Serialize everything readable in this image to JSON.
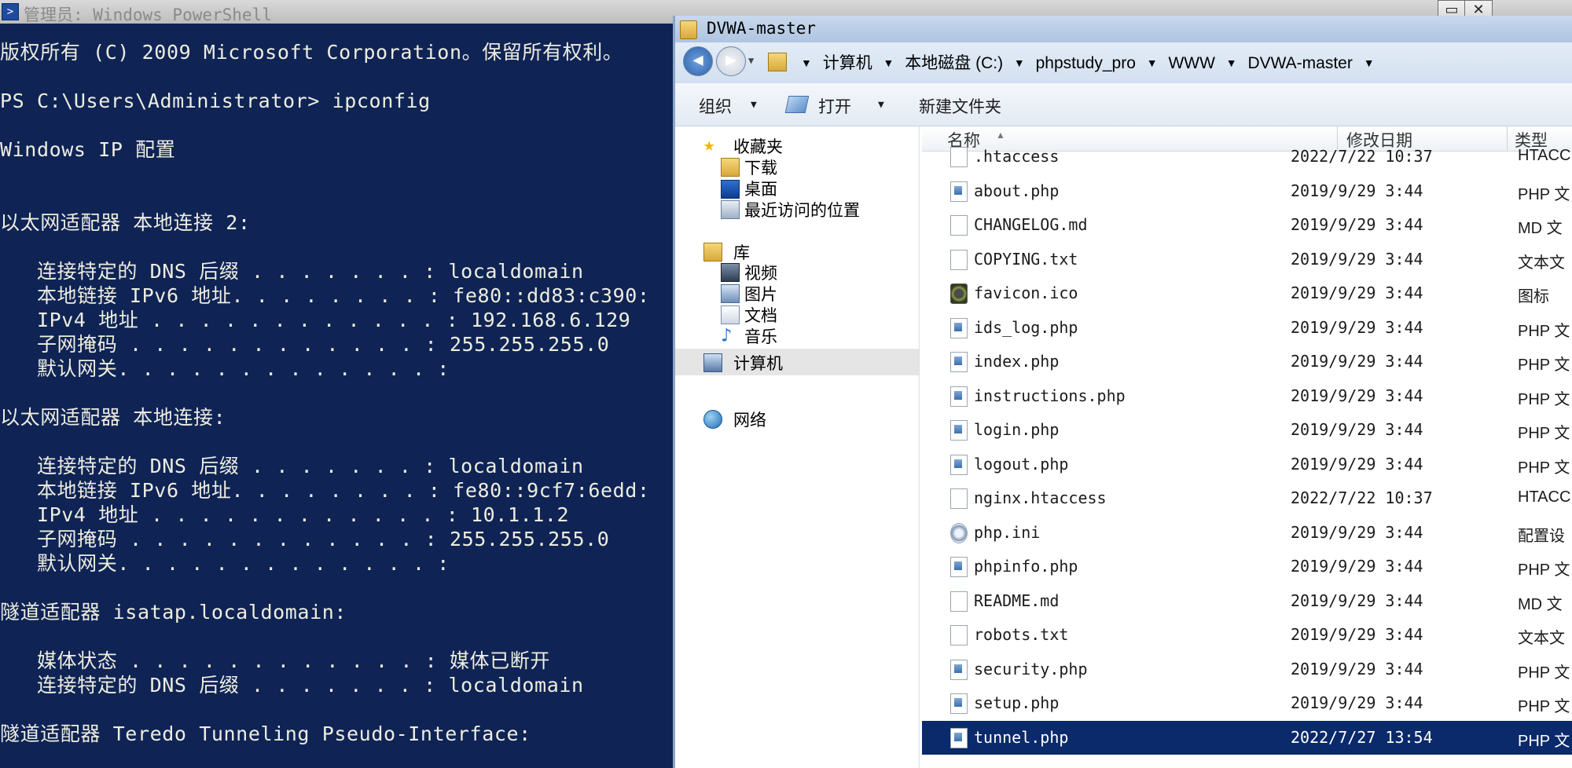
{
  "powershell": {
    "title": "管理员: Windows PowerShell",
    "lines": [
      "版权所有 (C) 2009 Microsoft Corporation。保留所有权利。",
      "",
      "PS C:\\Users\\Administrator> ipconfig",
      "",
      "Windows IP 配置",
      "",
      "",
      "以太网适配器 本地连接 2:",
      "",
      "   连接特定的 DNS 后缀 . . . . . . . : localdomain",
      "   本地链接 IPv6 地址. . . . . . . . : fe80::dd83:c390:",
      "   IPv4 地址 . . . . . . . . . . . . : 192.168.6.129",
      "   子网掩码 . . . . . . . . . . . . : 255.255.255.0",
      "   默认网关. . . . . . . . . . . . . :",
      "",
      "以太网适配器 本地连接:",
      "",
      "   连接特定的 DNS 后缀 . . . . . . . : localdomain",
      "   本地链接 IPv6 地址. . . . . . . . : fe80::9cf7:6edd:",
      "   IPv4 地址 . . . . . . . . . . . . : 10.1.1.2",
      "   子网掩码 . . . . . . . . . . . . : 255.255.255.0",
      "   默认网关. . . . . . . . . . . . . :",
      "",
      "隧道适配器 isatap.localdomain:",
      "",
      "   媒体状态 . . . . . . . . . . . . : 媒体已断开",
      "   连接特定的 DNS 后缀 . . . . . . . : localdomain",
      "",
      "隧道适配器 Teredo Tunneling Pseudo-Interface:",
      "",
      "   媒体状态 . . . . . . . . . . . . : 媒体已断开"
    ]
  },
  "explorer": {
    "title": "DVWA-master",
    "breadcrumb": [
      "计算机",
      "本地磁盘 (C:)",
      "phpstudy_pro",
      "WWW",
      "DVWA-master"
    ],
    "toolbar": {
      "organize": "组织",
      "open": "打开",
      "new_folder": "新建文件夹"
    },
    "nav": {
      "favorites": "收藏夹",
      "downloads": "下载",
      "desktop": "桌面",
      "recent": "最近访问的位置",
      "libraries": "库",
      "videos": "视频",
      "pictures": "图片",
      "documents": "文档",
      "music": "音乐",
      "computer": "计算机",
      "network": "网络"
    },
    "columns": {
      "name": "名称",
      "date": "修改日期",
      "type": "类型"
    },
    "files": [
      {
        "name": ".htaccess",
        "date": "2022/7/22 10:37",
        "type": "HTACC",
        "icon": "blank"
      },
      {
        "name": "about.php",
        "date": "2019/9/29 3:44",
        "type": "PHP 文",
        "icon": "php"
      },
      {
        "name": "CHANGELOG.md",
        "date": "2019/9/29 3:44",
        "type": "MD 文",
        "icon": "blank"
      },
      {
        "name": "COPYING.txt",
        "date": "2019/9/29 3:44",
        "type": "文本文",
        "icon": "blank"
      },
      {
        "name": "favicon.ico",
        "date": "2019/9/29 3:44",
        "type": "图标",
        "icon": "ico"
      },
      {
        "name": "ids_log.php",
        "date": "2019/9/29 3:44",
        "type": "PHP 文",
        "icon": "php"
      },
      {
        "name": "index.php",
        "date": "2019/9/29 3:44",
        "type": "PHP 文",
        "icon": "php"
      },
      {
        "name": "instructions.php",
        "date": "2019/9/29 3:44",
        "type": "PHP 文",
        "icon": "php"
      },
      {
        "name": "login.php",
        "date": "2019/9/29 3:44",
        "type": "PHP 文",
        "icon": "php"
      },
      {
        "name": "logout.php",
        "date": "2019/9/29 3:44",
        "type": "PHP 文",
        "icon": "php"
      },
      {
        "name": "nginx.htaccess",
        "date": "2022/7/22 10:37",
        "type": "HTACC",
        "icon": "blank"
      },
      {
        "name": "php.ini",
        "date": "2019/9/29 3:44",
        "type": "配置设",
        "icon": "ini"
      },
      {
        "name": "phpinfo.php",
        "date": "2019/9/29 3:44",
        "type": "PHP 文",
        "icon": "php"
      },
      {
        "name": "README.md",
        "date": "2019/9/29 3:44",
        "type": "MD 文",
        "icon": "blank"
      },
      {
        "name": "robots.txt",
        "date": "2019/9/29 3:44",
        "type": "文本文",
        "icon": "blank"
      },
      {
        "name": "security.php",
        "date": "2019/9/29 3:44",
        "type": "PHP 文",
        "icon": "php"
      },
      {
        "name": "setup.php",
        "date": "2019/9/29 3:44",
        "type": "PHP 文",
        "icon": "php"
      },
      {
        "name": "tunnel.php",
        "date": "2022/7/27 13:54",
        "type": "PHP 文",
        "icon": "php",
        "selected": true
      }
    ]
  }
}
